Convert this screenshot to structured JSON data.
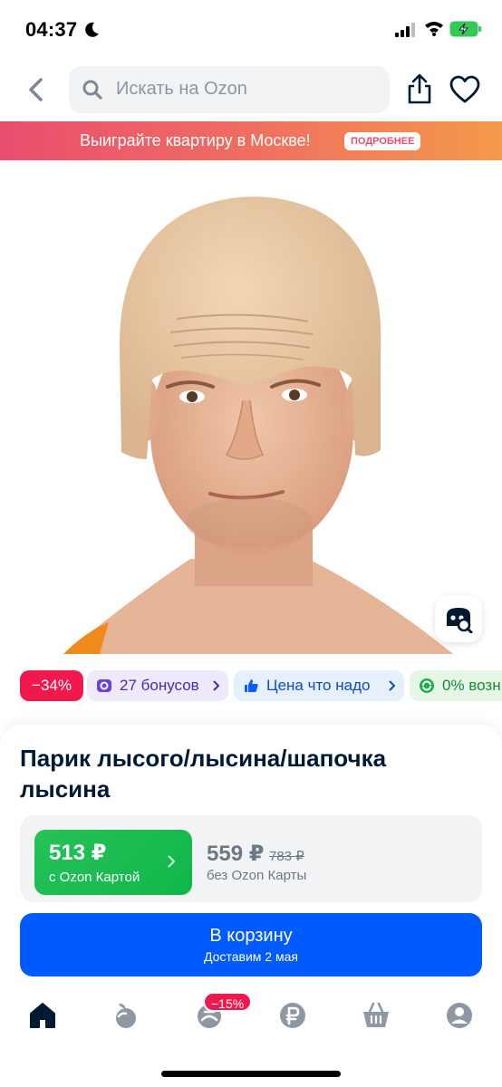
{
  "status_bar": {
    "time": "04:37"
  },
  "header": {
    "search_placeholder": "Искать на Ozon"
  },
  "banner": {
    "text": "Выиграйте квартиру в Москве!",
    "badge": "ПОДРОБНЕЕ"
  },
  "chips": {
    "discount": "−34%",
    "bonus": "27 бонусов",
    "price_tag": "Цена что надо",
    "installment": "0% возн"
  },
  "product": {
    "title": "Парик лысого/лысина/шапочка лысина",
    "ozon_card_price": "513 ₽",
    "ozon_card_label": "с Ozon Картой",
    "regular_price": "559 ₽",
    "old_price": "783 ₽",
    "regular_label": "без Ozon Карты"
  },
  "cart_button": {
    "label": "В корзину",
    "delivery": "Доставим 2 мая"
  },
  "bottom_nav": {
    "badge": "−15%"
  },
  "colors": {
    "accent": "#005bff",
    "discount": "#f1184e",
    "ozon_card": "#10c44c"
  }
}
